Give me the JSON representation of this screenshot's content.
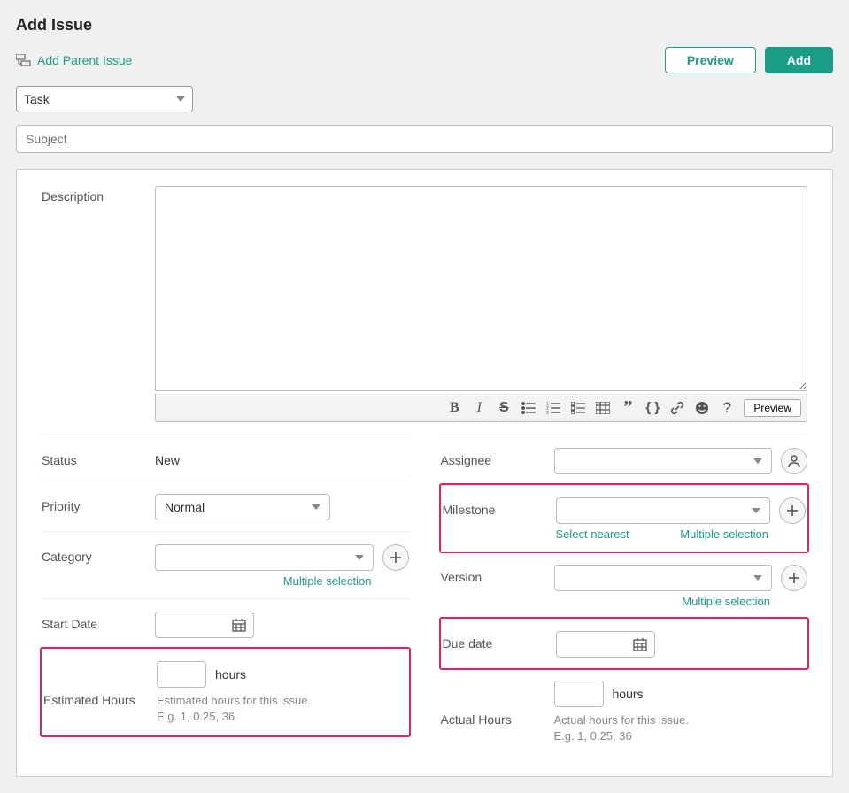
{
  "header": {
    "title": "Add Issue",
    "add_parent": "Add Parent Issue",
    "preview_btn": "Preview",
    "add_btn": "Add"
  },
  "type_select": {
    "value": "Task"
  },
  "subject": {
    "placeholder": "Subject"
  },
  "description": {
    "label": "Description"
  },
  "toolbar": {
    "preview": "Preview"
  },
  "left": {
    "status": {
      "label": "Status",
      "value": "New"
    },
    "priority": {
      "label": "Priority",
      "value": "Normal"
    },
    "category": {
      "label": "Category",
      "value": "",
      "multi": "Multiple selection"
    },
    "start_date": {
      "label": "Start Date"
    },
    "est_hours": {
      "label": "Estimated Hours",
      "unit": "hours",
      "help1": "Estimated hours for this issue.",
      "help2": "E.g. 1, 0.25, 36"
    }
  },
  "right": {
    "assignee": {
      "label": "Assignee",
      "value": ""
    },
    "milestone": {
      "label": "Milestone",
      "value": "",
      "nearest": "Select nearest",
      "multi": "Multiple selection"
    },
    "version": {
      "label": "Version",
      "value": "",
      "multi": "Multiple selection"
    },
    "due_date": {
      "label": "Due date"
    },
    "actual_hours": {
      "label": "Actual Hours",
      "unit": "hours",
      "help1": "Actual hours for this issue.",
      "help2": "E.g. 1, 0.25, 36"
    }
  }
}
